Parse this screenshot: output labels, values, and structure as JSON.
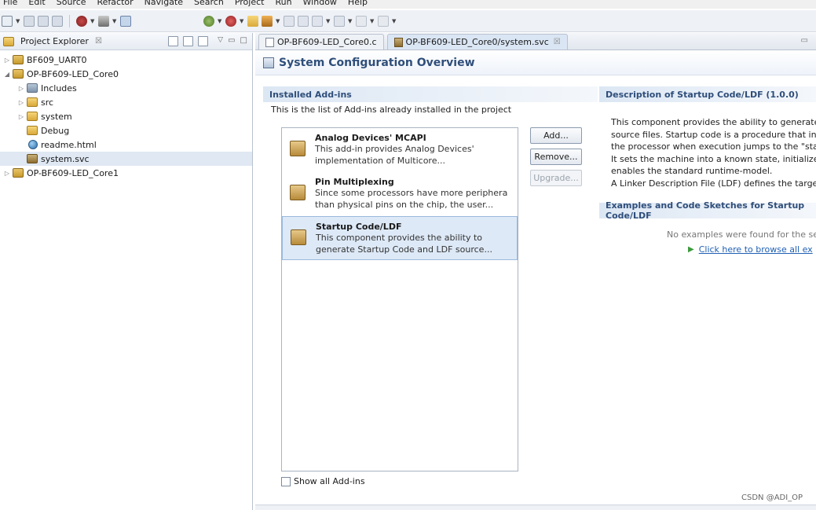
{
  "menu": [
    "File",
    "Edit",
    "Source",
    "Refactor",
    "Navigate",
    "Search",
    "Project",
    "Run",
    "Window",
    "Help"
  ],
  "explorer": {
    "title": "Project Explorer",
    "close": "☒",
    "items": [
      {
        "label": "BF609_UART0"
      },
      {
        "label": "OP-BF609-LED_Core0"
      },
      {
        "label": "Includes"
      },
      {
        "label": "src"
      },
      {
        "label": "system"
      },
      {
        "label": "Debug"
      },
      {
        "label": "readme.html"
      },
      {
        "label": "system.svc"
      },
      {
        "label": "OP-BF609-LED_Core1"
      }
    ]
  },
  "tabs": [
    {
      "label": "OP-BF609-LED_Core0.c"
    },
    {
      "label": "OP-BF609-LED_Core0/system.svc",
      "close": "☒"
    }
  ],
  "overview_title": "System Configuration Overview",
  "installed": {
    "heading": "Installed Add-ins",
    "description": "This is the list of Add-ins already installed in the project",
    "addins": [
      {
        "title": "Analog Devices' MCAPI",
        "desc1": "This add-in provides Analog Devices'",
        "desc2": "implementation of Multicore..."
      },
      {
        "title": "Pin Multiplexing",
        "desc1": "Since some processors have more periphera",
        "desc2": "than physical pins on the chip, the user..."
      },
      {
        "title": "Startup Code/LDF",
        "desc1": "This component provides the ability to",
        "desc2": "generate Startup Code and LDF source..."
      }
    ],
    "buttons": {
      "add": "Add...",
      "remove": "Remove...",
      "upgrade": "Upgrade..."
    },
    "show_all": "Show all Add-ins"
  },
  "description": {
    "heading": "Description of Startup Code/LDF (1.0.0)",
    "lines": [
      "This component provides the ability to generate",
      "source files. Startup code is a procedure that initi",
      "the processor when execution jumps to the \"start",
      "It sets the machine into a known state, initializes s",
      "enables the standard runtime-model.",
      "A Linker Description File (LDF) defines the target m"
    ]
  },
  "examples": {
    "heading": "Examples and Code Sketches for Startup Code/LDF",
    "none_found": "No examples were found for the sel",
    "browse_link": "Click here to browse all ex"
  },
  "watermark": "CSDN @ADI_OP",
  "colors": {
    "accent": "#2f4e7a",
    "selection": "#dde9f7",
    "link": "#1f5fb4"
  }
}
